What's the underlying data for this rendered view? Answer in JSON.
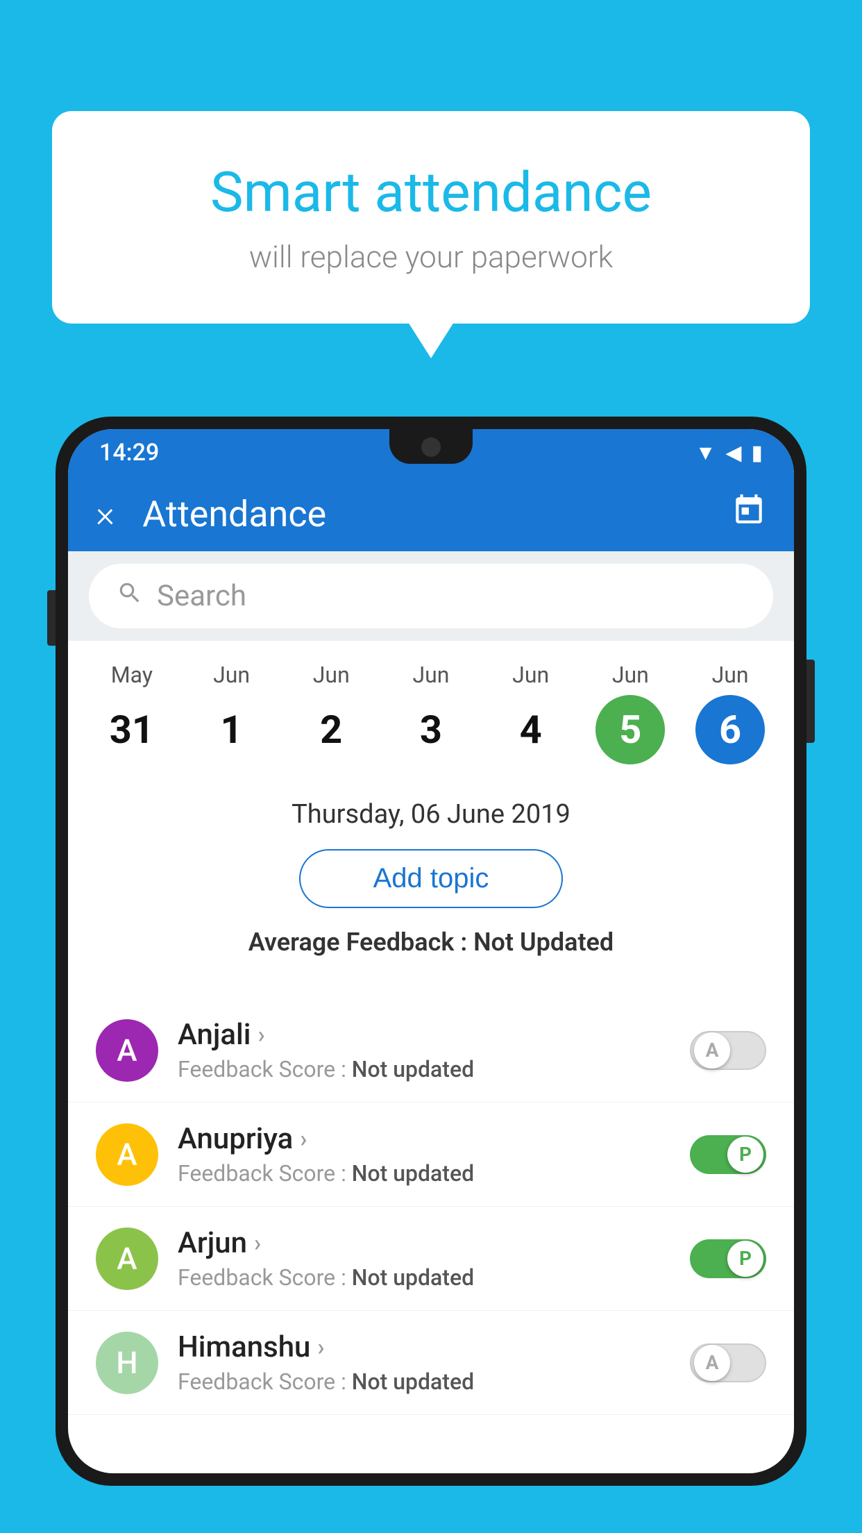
{
  "background_color": "#1ab9e8",
  "speech_bubble": {
    "title": "Smart attendance",
    "subtitle": "will replace your paperwork"
  },
  "status_bar": {
    "time": "14:29",
    "icons": [
      "wifi",
      "signal",
      "battery"
    ]
  },
  "app_bar": {
    "title": "Attendance",
    "close_label": "×",
    "calendar_icon": "📅"
  },
  "search": {
    "placeholder": "Search"
  },
  "calendar": {
    "days": [
      {
        "month": "May",
        "date": "31",
        "state": "normal"
      },
      {
        "month": "Jun",
        "date": "1",
        "state": "normal"
      },
      {
        "month": "Jun",
        "date": "2",
        "state": "normal"
      },
      {
        "month": "Jun",
        "date": "3",
        "state": "normal"
      },
      {
        "month": "Jun",
        "date": "4",
        "state": "normal"
      },
      {
        "month": "Jun",
        "date": "5",
        "state": "today"
      },
      {
        "month": "Jun",
        "date": "6",
        "state": "selected"
      }
    ]
  },
  "selected_date_label": "Thursday, 06 June 2019",
  "add_topic_label": "Add topic",
  "avg_feedback_label": "Average Feedback :",
  "avg_feedback_value": "Not Updated",
  "students": [
    {
      "name": "Anjali",
      "avatar_letter": "A",
      "avatar_color": "#9c27b0",
      "feedback_label": "Feedback Score :",
      "feedback_value": "Not updated",
      "attendance": "absent",
      "toggle_label": "A"
    },
    {
      "name": "Anupriya",
      "avatar_letter": "A",
      "avatar_color": "#ffc107",
      "feedback_label": "Feedback Score :",
      "feedback_value": "Not updated",
      "attendance": "present",
      "toggle_label": "P"
    },
    {
      "name": "Arjun",
      "avatar_letter": "A",
      "avatar_color": "#8bc34a",
      "feedback_label": "Feedback Score :",
      "feedback_value": "Not updated",
      "attendance": "present",
      "toggle_label": "P"
    },
    {
      "name": "Himanshu",
      "avatar_letter": "H",
      "avatar_color": "#a5d6a7",
      "feedback_label": "Feedback Score :",
      "feedback_value": "Not updated",
      "attendance": "absent",
      "toggle_label": "A"
    }
  ]
}
